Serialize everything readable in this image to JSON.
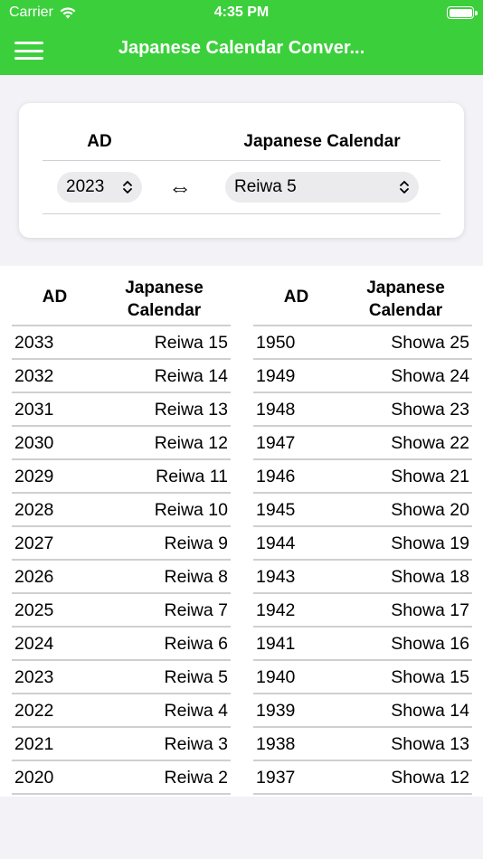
{
  "status_bar": {
    "carrier": "Carrier",
    "time": "4:35 PM"
  },
  "nav": {
    "title": "Japanese Calendar Conver...",
    "menu_icon": "hamburger-menu-icon",
    "color": "#3ccf3c"
  },
  "converter": {
    "ad_header": "AD",
    "jp_header": "Japanese Calendar",
    "year_value": "2023",
    "era_value": "Reiwa 5",
    "swap_symbol": "⇔"
  },
  "table_left": {
    "header_ad": "AD",
    "header_jp_line1": "Japanese",
    "header_jp_line2": "Calendar",
    "rows": [
      {
        "ad": "2033",
        "jp": "Reiwa 15"
      },
      {
        "ad": "2032",
        "jp": "Reiwa 14"
      },
      {
        "ad": "2031",
        "jp": "Reiwa 13"
      },
      {
        "ad": "2030",
        "jp": "Reiwa 12"
      },
      {
        "ad": "2029",
        "jp": "Reiwa 11"
      },
      {
        "ad": "2028",
        "jp": "Reiwa 10"
      },
      {
        "ad": "2027",
        "jp": "Reiwa 9"
      },
      {
        "ad": "2026",
        "jp": "Reiwa 8"
      },
      {
        "ad": "2025",
        "jp": "Reiwa 7"
      },
      {
        "ad": "2024",
        "jp": "Reiwa 6"
      },
      {
        "ad": "2023",
        "jp": "Reiwa 5"
      },
      {
        "ad": "2022",
        "jp": "Reiwa 4"
      },
      {
        "ad": "2021",
        "jp": "Reiwa 3"
      },
      {
        "ad": "2020",
        "jp": "Reiwa 2"
      }
    ]
  },
  "table_right": {
    "header_ad": "AD",
    "header_jp_line1": "Japanese",
    "header_jp_line2": "Calendar",
    "rows": [
      {
        "ad": "1950",
        "jp": "Showa 25"
      },
      {
        "ad": "1949",
        "jp": "Showa 24"
      },
      {
        "ad": "1948",
        "jp": "Showa 23"
      },
      {
        "ad": "1947",
        "jp": "Showa 22"
      },
      {
        "ad": "1946",
        "jp": "Showa 21"
      },
      {
        "ad": "1945",
        "jp": "Showa 20"
      },
      {
        "ad": "1944",
        "jp": "Showa 19"
      },
      {
        "ad": "1943",
        "jp": "Showa 18"
      },
      {
        "ad": "1942",
        "jp": "Showa 17"
      },
      {
        "ad": "1941",
        "jp": "Showa 16"
      },
      {
        "ad": "1940",
        "jp": "Showa 15"
      },
      {
        "ad": "1939",
        "jp": "Showa 14"
      },
      {
        "ad": "1938",
        "jp": "Showa 13"
      },
      {
        "ad": "1937",
        "jp": "Showa 12"
      }
    ]
  }
}
